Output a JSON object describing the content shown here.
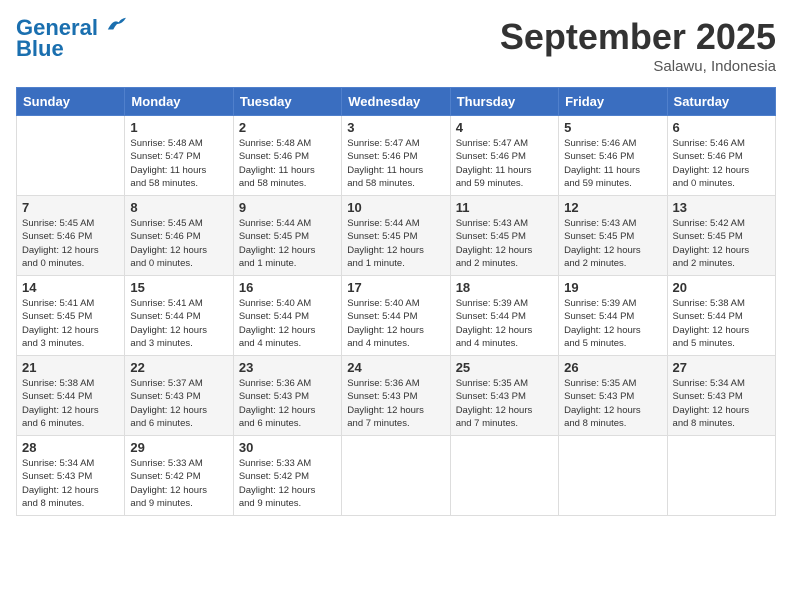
{
  "logo": {
    "line1": "General",
    "line2": "Blue"
  },
  "title": "September 2025",
  "subtitle": "Salawu, Indonesia",
  "header_days": [
    "Sunday",
    "Monday",
    "Tuesday",
    "Wednesday",
    "Thursday",
    "Friday",
    "Saturday"
  ],
  "weeks": [
    [
      {
        "day": "",
        "info": ""
      },
      {
        "day": "1",
        "info": "Sunrise: 5:48 AM\nSunset: 5:47 PM\nDaylight: 11 hours\nand 58 minutes."
      },
      {
        "day": "2",
        "info": "Sunrise: 5:48 AM\nSunset: 5:46 PM\nDaylight: 11 hours\nand 58 minutes."
      },
      {
        "day": "3",
        "info": "Sunrise: 5:47 AM\nSunset: 5:46 PM\nDaylight: 11 hours\nand 58 minutes."
      },
      {
        "day": "4",
        "info": "Sunrise: 5:47 AM\nSunset: 5:46 PM\nDaylight: 11 hours\nand 59 minutes."
      },
      {
        "day": "5",
        "info": "Sunrise: 5:46 AM\nSunset: 5:46 PM\nDaylight: 11 hours\nand 59 minutes."
      },
      {
        "day": "6",
        "info": "Sunrise: 5:46 AM\nSunset: 5:46 PM\nDaylight: 12 hours\nand 0 minutes."
      }
    ],
    [
      {
        "day": "7",
        "info": "Sunrise: 5:45 AM\nSunset: 5:46 PM\nDaylight: 12 hours\nand 0 minutes."
      },
      {
        "day": "8",
        "info": "Sunrise: 5:45 AM\nSunset: 5:46 PM\nDaylight: 12 hours\nand 0 minutes."
      },
      {
        "day": "9",
        "info": "Sunrise: 5:44 AM\nSunset: 5:45 PM\nDaylight: 12 hours\nand 1 minute."
      },
      {
        "day": "10",
        "info": "Sunrise: 5:44 AM\nSunset: 5:45 PM\nDaylight: 12 hours\nand 1 minute."
      },
      {
        "day": "11",
        "info": "Sunrise: 5:43 AM\nSunset: 5:45 PM\nDaylight: 12 hours\nand 2 minutes."
      },
      {
        "day": "12",
        "info": "Sunrise: 5:43 AM\nSunset: 5:45 PM\nDaylight: 12 hours\nand 2 minutes."
      },
      {
        "day": "13",
        "info": "Sunrise: 5:42 AM\nSunset: 5:45 PM\nDaylight: 12 hours\nand 2 minutes."
      }
    ],
    [
      {
        "day": "14",
        "info": "Sunrise: 5:41 AM\nSunset: 5:45 PM\nDaylight: 12 hours\nand 3 minutes."
      },
      {
        "day": "15",
        "info": "Sunrise: 5:41 AM\nSunset: 5:44 PM\nDaylight: 12 hours\nand 3 minutes."
      },
      {
        "day": "16",
        "info": "Sunrise: 5:40 AM\nSunset: 5:44 PM\nDaylight: 12 hours\nand 4 minutes."
      },
      {
        "day": "17",
        "info": "Sunrise: 5:40 AM\nSunset: 5:44 PM\nDaylight: 12 hours\nand 4 minutes."
      },
      {
        "day": "18",
        "info": "Sunrise: 5:39 AM\nSunset: 5:44 PM\nDaylight: 12 hours\nand 4 minutes."
      },
      {
        "day": "19",
        "info": "Sunrise: 5:39 AM\nSunset: 5:44 PM\nDaylight: 12 hours\nand 5 minutes."
      },
      {
        "day": "20",
        "info": "Sunrise: 5:38 AM\nSunset: 5:44 PM\nDaylight: 12 hours\nand 5 minutes."
      }
    ],
    [
      {
        "day": "21",
        "info": "Sunrise: 5:38 AM\nSunset: 5:44 PM\nDaylight: 12 hours\nand 6 minutes."
      },
      {
        "day": "22",
        "info": "Sunrise: 5:37 AM\nSunset: 5:43 PM\nDaylight: 12 hours\nand 6 minutes."
      },
      {
        "day": "23",
        "info": "Sunrise: 5:36 AM\nSunset: 5:43 PM\nDaylight: 12 hours\nand 6 minutes."
      },
      {
        "day": "24",
        "info": "Sunrise: 5:36 AM\nSunset: 5:43 PM\nDaylight: 12 hours\nand 7 minutes."
      },
      {
        "day": "25",
        "info": "Sunrise: 5:35 AM\nSunset: 5:43 PM\nDaylight: 12 hours\nand 7 minutes."
      },
      {
        "day": "26",
        "info": "Sunrise: 5:35 AM\nSunset: 5:43 PM\nDaylight: 12 hours\nand 8 minutes."
      },
      {
        "day": "27",
        "info": "Sunrise: 5:34 AM\nSunset: 5:43 PM\nDaylight: 12 hours\nand 8 minutes."
      }
    ],
    [
      {
        "day": "28",
        "info": "Sunrise: 5:34 AM\nSunset: 5:43 PM\nDaylight: 12 hours\nand 8 minutes."
      },
      {
        "day": "29",
        "info": "Sunrise: 5:33 AM\nSunset: 5:42 PM\nDaylight: 12 hours\nand 9 minutes."
      },
      {
        "day": "30",
        "info": "Sunrise: 5:33 AM\nSunset: 5:42 PM\nDaylight: 12 hours\nand 9 minutes."
      },
      {
        "day": "",
        "info": ""
      },
      {
        "day": "",
        "info": ""
      },
      {
        "day": "",
        "info": ""
      },
      {
        "day": "",
        "info": ""
      }
    ]
  ]
}
